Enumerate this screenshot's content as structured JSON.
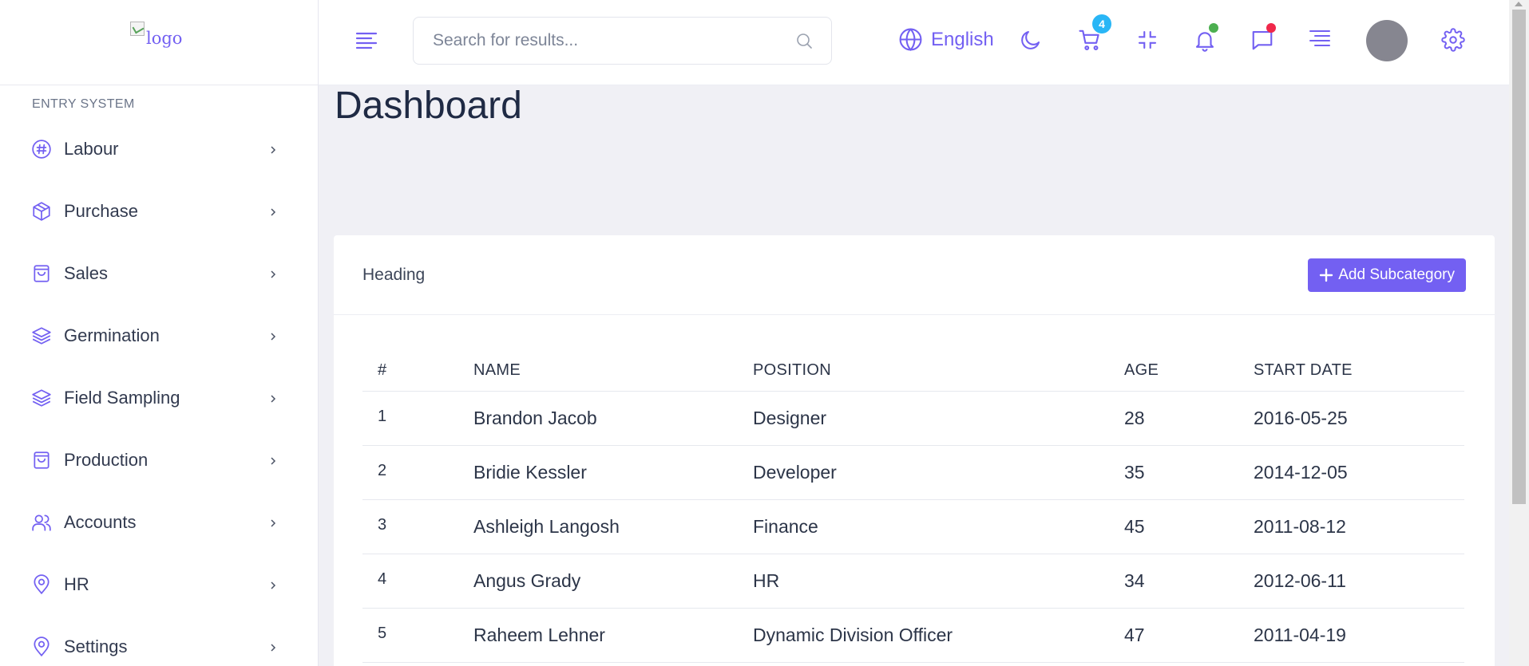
{
  "logo": {
    "alt": "logo"
  },
  "sidebar": {
    "section_title": "ENTRY SYSTEM",
    "items": [
      {
        "label": "Labour",
        "icon": "hash-icon"
      },
      {
        "label": "Purchase",
        "icon": "box-icon"
      },
      {
        "label": "Sales",
        "icon": "shopping-bag-icon"
      },
      {
        "label": "Germination",
        "icon": "layers-icon"
      },
      {
        "label": "Field Sampling",
        "icon": "layers-icon"
      },
      {
        "label": "Production",
        "icon": "shopping-bag-icon"
      },
      {
        "label": "Accounts",
        "icon": "users-icon"
      },
      {
        "label": "HR",
        "icon": "map-pin-icon"
      },
      {
        "label": "Settings",
        "icon": "map-pin-icon"
      }
    ]
  },
  "header": {
    "search_placeholder": "Search for results...",
    "language": "English",
    "cart_count": "4",
    "accent": "#7360f2",
    "notification_dot_color": "#4caf50",
    "message_dot_color": "#f0284a"
  },
  "main": {
    "page_title": "Dashboard",
    "card_heading": "Heading",
    "add_button_label": "Add Subcategory",
    "table": {
      "headers": [
        "#",
        "NAME",
        "POSITION",
        "AGE",
        "START DATE"
      ],
      "rows": [
        [
          "1",
          "Brandon Jacob",
          "Designer",
          "28",
          "2016-05-25"
        ],
        [
          "2",
          "Bridie Kessler",
          "Developer",
          "35",
          "2014-12-05"
        ],
        [
          "3",
          "Ashleigh Langosh",
          "Finance",
          "45",
          "2011-08-12"
        ],
        [
          "4",
          "Angus Grady",
          "HR",
          "34",
          "2012-06-11"
        ],
        [
          "5",
          "Raheem Lehner",
          "Dynamic Division Officer",
          "47",
          "2011-04-19"
        ]
      ]
    }
  }
}
